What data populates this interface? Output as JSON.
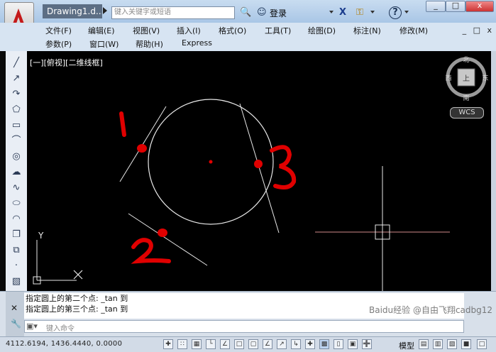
{
  "titlebar": {
    "doc_title": "Drawing1.d...",
    "search_placeholder": "键入关键字或短语",
    "login_label": "登录",
    "help_label": "?",
    "window_buttons": [
      "_",
      "□",
      "x"
    ]
  },
  "menubar": {
    "row1": [
      "文件(F)",
      "编辑(E)",
      "视图(V)",
      "插入(I)",
      "格式(O)",
      "工具(T)",
      "绘图(D)",
      "标注(N)",
      "修改(M)"
    ],
    "row2": [
      "参数(P)",
      "窗口(W)",
      "帮助(H)",
      "Express"
    ],
    "mdi_buttons": [
      "_",
      "□",
      "x"
    ]
  },
  "canvas": {
    "viewport_label": "[一][俯视][二维线框]",
    "compass": {
      "north": "北",
      "south": "南",
      "east": "东",
      "west": "西",
      "center": "上"
    },
    "wcs_label": "WCS",
    "axis_y": "Y",
    "annotations": [
      "1",
      "2",
      "3"
    ]
  },
  "command": {
    "history": [
      "指定圆上的第二个点: _tan 到",
      "指定圆上的第三个点: _tan 到"
    ],
    "input_placeholder": "键入命令"
  },
  "statusbar": {
    "coords": "4112.6194,  1436.4440,  0.0000",
    "model_label": "模型"
  },
  "watermark": "Baidu经验 @自由飞翔cadbg12",
  "colors": {
    "canvas_bg": "#000000",
    "accent_red": "#e00000",
    "chrome": "#d7e4f2"
  }
}
